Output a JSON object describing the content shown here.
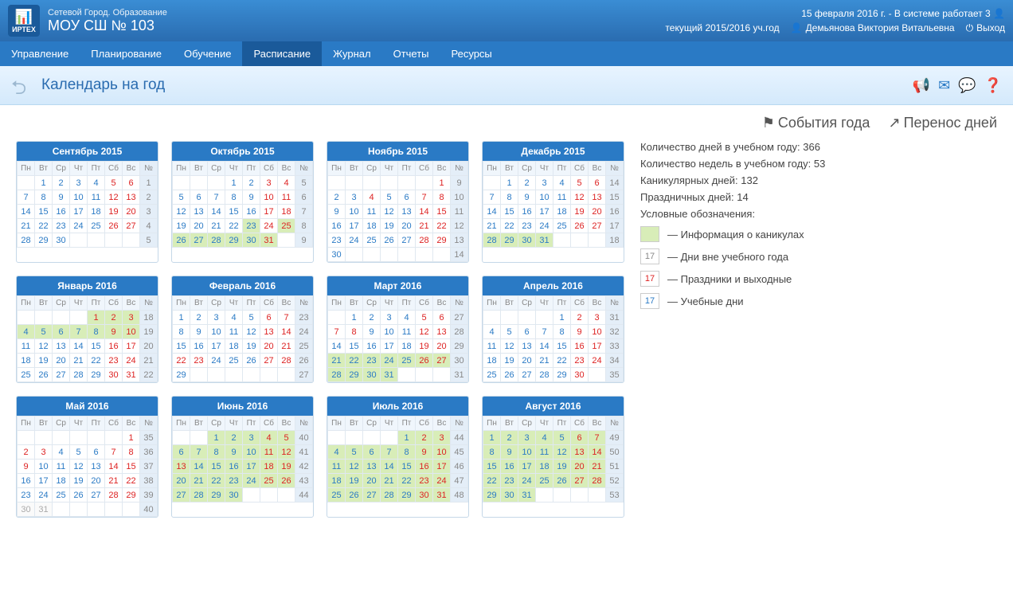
{
  "header": {
    "subtitle": "Сетевой Город. Образование",
    "school": "МОУ СШ № 103",
    "date": "15 февраля 2016 г.",
    "status": "- В системе работает 3",
    "year": "текущий 2015/2016 уч.год",
    "user": "Демьянова Виктория Витальевна",
    "exit": "Выход"
  },
  "nav": [
    "Управление",
    "Планирование",
    "Обучение",
    "Расписание",
    "Журнал",
    "Отчеты",
    "Ресурсы"
  ],
  "nav_active": 3,
  "page_title": "Календарь на год",
  "actions": {
    "events": "События года",
    "transfer": "Перенос дней"
  },
  "stats": {
    "days": "Количество дней в учебном году: 366",
    "weeks": "Количество недель в учебном году: 53",
    "vacation": "Каникулярных дней: 132",
    "holidays": "Праздничных дней: 14",
    "legend_title": "Условные обозначения:"
  },
  "legend": {
    "vac": "— Информация о каникулах",
    "out": "— Дни вне учебного года",
    "hol": "— Праздники и выходные",
    "sch": "— Учебные дни"
  },
  "dow": [
    "Пн",
    "Вт",
    "Ср",
    "Чт",
    "Пт",
    "Сб",
    "Вс",
    "№"
  ],
  "months": [
    {
      "title": "Сентябрь 2015",
      "startDow": 1,
      "days": 30,
      "firstWeek": 1,
      "hol": [
        5,
        6,
        12,
        13,
        19,
        20,
        26,
        27
      ],
      "vac": [],
      "out": []
    },
    {
      "title": "Октябрь 2015",
      "startDow": 3,
      "days": 31,
      "firstWeek": 5,
      "hol": [
        3,
        4,
        10,
        11,
        17,
        18,
        24,
        25,
        31
      ],
      "vac": [
        23,
        25,
        26,
        27,
        28,
        29,
        30,
        31
      ],
      "out": []
    },
    {
      "title": "Ноябрь 2015",
      "startDow": 6,
      "days": 30,
      "firstWeek": 9,
      "hol": [
        1,
        4,
        7,
        8,
        14,
        15,
        21,
        22,
        28,
        29
      ],
      "vac": [],
      "out": []
    },
    {
      "title": "Декабрь 2015",
      "startDow": 1,
      "days": 31,
      "firstWeek": 14,
      "hol": [
        5,
        6,
        12,
        13,
        19,
        20,
        26,
        27
      ],
      "vac": [
        28,
        29,
        30,
        31
      ],
      "out": []
    },
    {
      "title": "Январь 2016",
      "startDow": 4,
      "days": 31,
      "firstWeek": 18,
      "hol": [
        1,
        2,
        3,
        9,
        10,
        16,
        17,
        23,
        24,
        30,
        31
      ],
      "vac": [
        1,
        2,
        3,
        4,
        5,
        6,
        7,
        8,
        9,
        10
      ],
      "out": []
    },
    {
      "title": "Февраль 2016",
      "startDow": 0,
      "days": 29,
      "firstWeek": 23,
      "hol": [
        6,
        7,
        13,
        14,
        20,
        21,
        22,
        23,
        27,
        28
      ],
      "vac": [],
      "out": []
    },
    {
      "title": "Март 2016",
      "startDow": 1,
      "days": 31,
      "firstWeek": 27,
      "hol": [
        5,
        6,
        7,
        8,
        12,
        13,
        19,
        20,
        26,
        27
      ],
      "vac": [
        21,
        22,
        23,
        24,
        25,
        26,
        27,
        28,
        29,
        30,
        31
      ],
      "out": []
    },
    {
      "title": "Апрель 2016",
      "startDow": 4,
      "days": 30,
      "firstWeek": 31,
      "hol": [
        2,
        3,
        9,
        10,
        16,
        17,
        23,
        24,
        30
      ],
      "vac": [],
      "out": []
    },
    {
      "title": "Май 2016",
      "startDow": 6,
      "days": 31,
      "firstWeek": 35,
      "hol": [
        1,
        2,
        3,
        7,
        8,
        9,
        14,
        15,
        21,
        22,
        28,
        29
      ],
      "vac": [],
      "out": [
        30,
        31
      ]
    },
    {
      "title": "Июнь 2016",
      "startDow": 2,
      "days": 30,
      "firstWeek": 40,
      "hol": [
        4,
        5,
        11,
        12,
        13,
        18,
        19,
        25,
        26
      ],
      "vac": [
        1,
        2,
        3,
        4,
        5,
        6,
        7,
        8,
        9,
        10,
        11,
        12,
        13,
        14,
        15,
        16,
        17,
        18,
        19,
        20,
        21,
        22,
        23,
        24,
        25,
        26,
        27,
        28,
        29,
        30
      ],
      "out": []
    },
    {
      "title": "Июль 2016",
      "startDow": 4,
      "days": 31,
      "firstWeek": 44,
      "hol": [
        2,
        3,
        9,
        10,
        16,
        17,
        23,
        24,
        30,
        31
      ],
      "vac": [
        1,
        2,
        3,
        4,
        5,
        6,
        7,
        8,
        9,
        10,
        11,
        12,
        13,
        14,
        15,
        16,
        17,
        18,
        19,
        20,
        21,
        22,
        23,
        24,
        25,
        26,
        27,
        28,
        29,
        30,
        31
      ],
      "out": []
    },
    {
      "title": "Август 2016",
      "startDow": 0,
      "days": 31,
      "firstWeek": 49,
      "hol": [
        6,
        7,
        13,
        14,
        20,
        21,
        27,
        28
      ],
      "vac": [
        1,
        2,
        3,
        4,
        5,
        6,
        7,
        8,
        9,
        10,
        11,
        12,
        13,
        14,
        15,
        16,
        17,
        18,
        19,
        20,
        21,
        22,
        23,
        24,
        25,
        26,
        27,
        28,
        29,
        30,
        31
      ],
      "out": []
    }
  ]
}
